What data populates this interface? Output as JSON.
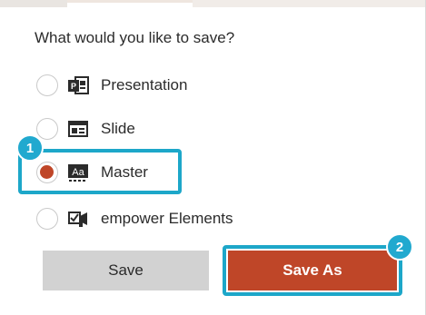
{
  "dialog": {
    "question": "What would you like to save?"
  },
  "options": [
    {
      "label": "Presentation",
      "icon": "powerpoint-presentation-icon",
      "selected": false
    },
    {
      "label": "Slide",
      "icon": "slide-layout-icon",
      "selected": false
    },
    {
      "label": "Master",
      "icon": "slide-master-icon",
      "selected": true
    },
    {
      "label": "empower Elements",
      "icon": "empower-elements-icon",
      "selected": false
    }
  ],
  "buttons": {
    "save_label": "Save",
    "save_as_label": "Save As"
  },
  "callouts": {
    "step_1": "1",
    "step_2": "2"
  },
  "colors": {
    "accent": "#bf4628",
    "highlight": "#1da7c9",
    "badge": "#21a9cf",
    "secondary_button": "#d2d2d2"
  }
}
